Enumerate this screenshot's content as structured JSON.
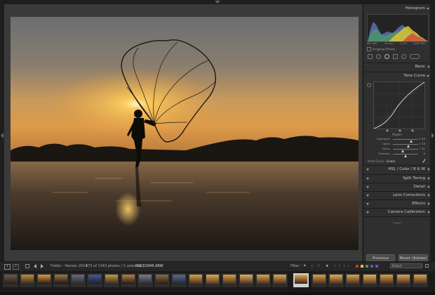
{
  "app": {
    "name": "Lightroom Develop"
  },
  "right_panel": {
    "histogram_label": "Histogram",
    "hist_meta": {
      "iso": "ISO 400",
      "focal": "24 mm",
      "aperture": "f / 8.0",
      "shutter": "1/500 SEC"
    },
    "original_photo_label": "Original Photo",
    "sections": {
      "basic": "Basic",
      "tone_curve": "Tone Curve",
      "hsl": "HSL  /  Color  /  B & W",
      "split_toning": "Split Toning",
      "detail": "Detail",
      "lens_corrections": "Lens Corrections",
      "effects": "Effects",
      "camera_calibration": "Camera Calibration"
    },
    "region_label": "Region",
    "sliders": [
      {
        "label": "Highlights",
        "value": "+ 52",
        "level": 0.72
      },
      {
        "label": "Lights",
        "value": "+ 29",
        "level": 0.62
      },
      {
        "label": "Darks",
        "value": "− 21",
        "level": 0.4
      },
      {
        "label": "Shadows",
        "value": "0",
        "level": 0.5
      }
    ],
    "point_curve_label": "Point Curve :",
    "point_curve_value": "Linear",
    "previous_button": "Previous",
    "reset_button": "Reset (Adobe)"
  },
  "status_bar": {
    "page_a": "1",
    "page_b": "2",
    "folder_text": "Folder : Hemen 2014",
    "count_text": "373 of 1343 photos / 1 selected /",
    "filename": "DSC02946.ARW",
    "filter_label": "Filter :",
    "filter_value": "Rated"
  },
  "colors": {
    "accent": "#e9a43a",
    "panel": "#2f2f2f",
    "background": "#3a3a3a"
  }
}
